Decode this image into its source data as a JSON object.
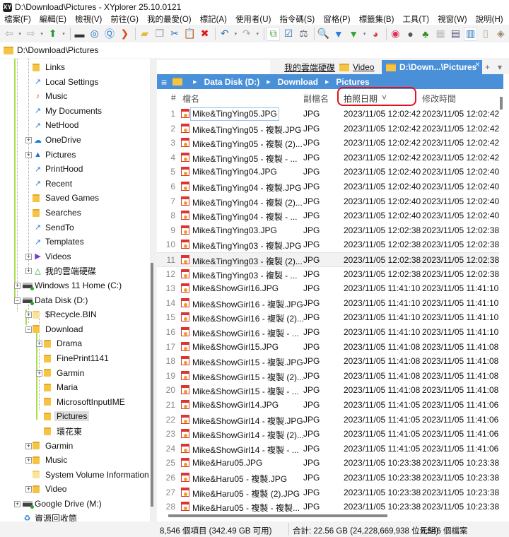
{
  "window": {
    "title": "D:\\Download\\Pictures - XYplorer 25.10.0121",
    "logo": "XY"
  },
  "menu": [
    "檔案(F)",
    "編輯(E)",
    "檢視(V)",
    "前往(G)",
    "我的最愛(O)",
    "標記(A)",
    "使用者(U)",
    "指令碼(S)",
    "窗格(P)",
    "標籤集(B)",
    "工具(T)",
    "視窗(W)",
    "說明(H)"
  ],
  "toolbar": [
    {
      "name": "back-icon",
      "glyph": "⇦",
      "color": "#9aa",
      "dd": true
    },
    {
      "name": "forward-icon",
      "glyph": "⇨",
      "color": "#9aa",
      "dd": true
    },
    {
      "name": "up-icon",
      "glyph": "⬆",
      "color": "#2a9a3a",
      "dd": true
    },
    {
      "sep": true
    },
    {
      "name": "computer-icon",
      "glyph": "▬",
      "color": "#333"
    },
    {
      "name": "target-icon",
      "glyph": "◎",
      "color": "#2a6fb8"
    },
    {
      "name": "search-circle-icon",
      "glyph": "Ⓠ",
      "color": "#2a7fd8"
    },
    {
      "name": "goto-icon",
      "glyph": "❯",
      "color": "#e04a1a"
    },
    {
      "sep": true
    },
    {
      "name": "new-folder-icon",
      "glyph": "▰",
      "color": "#e8b93a"
    },
    {
      "name": "copy-icon",
      "glyph": "❐",
      "color": "#999"
    },
    {
      "name": "cut-icon",
      "glyph": "✂",
      "color": "#2a6fb8"
    },
    {
      "name": "paste-icon",
      "glyph": "📋",
      "color": "#a87"
    },
    {
      "name": "delete-icon",
      "glyph": "✖",
      "color": "#e01a1a"
    },
    {
      "sep": true
    },
    {
      "name": "undo-icon",
      "glyph": "↶",
      "color": "#2a6fb8",
      "dd": true
    },
    {
      "name": "redo-icon",
      "glyph": "↷",
      "color": "#aab",
      "dd": true
    },
    {
      "sep": true
    },
    {
      "name": "tree-toggle-icon",
      "glyph": "⧉",
      "color": "#4a4",
      "on": true
    },
    {
      "name": "checkbox-icon",
      "glyph": "☑",
      "color": "#2a6fb8"
    },
    {
      "name": "weight-icon",
      "glyph": "⚖",
      "color": "#667"
    },
    {
      "sep": true
    },
    {
      "name": "find-icon",
      "glyph": "🔍",
      "color": "#2a7fd8"
    },
    {
      "name": "filter-icon",
      "glyph": "▼",
      "color": "#2a7fd8"
    },
    {
      "name": "green-filter-icon",
      "glyph": "▼",
      "color": "#3aa53a",
      "dd": true
    },
    {
      "name": "pie-icon",
      "glyph": "◕",
      "color": "#e03a3a"
    },
    {
      "sep": true
    },
    {
      "name": "spiral-icon",
      "glyph": "◉",
      "color": "#e0305a"
    },
    {
      "name": "moon-icon",
      "glyph": "●",
      "color": "#555"
    },
    {
      "name": "tree-icon",
      "glyph": "♣",
      "color": "#3a8a2a"
    },
    {
      "name": "grid-icon",
      "glyph": "▦",
      "color": "#bbb"
    },
    {
      "name": "details-icon",
      "glyph": "▤",
      "color": "#557"
    },
    {
      "name": "dual-pane-icon",
      "glyph": "▥",
      "color": "#2a6fb8",
      "on": true
    },
    {
      "name": "panel-icon",
      "glyph": "▯",
      "color": "#b9a37a"
    },
    {
      "name": "tag-icon",
      "glyph": "◈",
      "color": "#998866"
    }
  ],
  "address": "D:\\Download\\Pictures",
  "tree": [
    {
      "label": "Links",
      "level": 1,
      "icon": "folder"
    },
    {
      "label": "Local Settings",
      "level": 1,
      "icon": "shortcut"
    },
    {
      "label": "Music",
      "level": 1,
      "icon": "music"
    },
    {
      "label": "My Documents",
      "level": 1,
      "icon": "shortcut"
    },
    {
      "label": "NetHood",
      "level": 1,
      "icon": "shortcut"
    },
    {
      "label": "OneDrive",
      "level": 1,
      "icon": "cloud",
      "exp": "+"
    },
    {
      "label": "Pictures",
      "level": 1,
      "icon": "pictures",
      "exp": "+"
    },
    {
      "label": "PrintHood",
      "level": 1,
      "icon": "shortcut"
    },
    {
      "label": "Recent",
      "level": 1,
      "icon": "shortcut"
    },
    {
      "label": "Saved Games",
      "level": 1,
      "icon": "folder"
    },
    {
      "label": "Searches",
      "level": 1,
      "icon": "folder"
    },
    {
      "label": "SendTo",
      "level": 1,
      "icon": "shortcut"
    },
    {
      "label": "Templates",
      "level": 1,
      "icon": "shortcut"
    },
    {
      "label": "Videos",
      "level": 1,
      "icon": "video",
      "exp": "+"
    },
    {
      "label": "我的雲端硬碟",
      "level": 1,
      "icon": "gdrive",
      "exp": "+"
    },
    {
      "label": "Windows 11 Home (C:)",
      "level": 0,
      "icon": "drive",
      "exp": "+"
    },
    {
      "label": "Data Disk (D:)",
      "level": 0,
      "icon": "drive",
      "exp": "−"
    },
    {
      "label": "$Recycle.BIN",
      "level": 1,
      "icon": "folder-light",
      "exp": "+"
    },
    {
      "label": "Download",
      "level": 1,
      "icon": "folder",
      "exp": "−"
    },
    {
      "label": "Drama",
      "level": 2,
      "icon": "folder",
      "exp": "+"
    },
    {
      "label": "FinePrint1141",
      "level": 2,
      "icon": "folder"
    },
    {
      "label": "Garmin",
      "level": 2,
      "icon": "folder",
      "exp": "+"
    },
    {
      "label": "Maria",
      "level": 2,
      "icon": "folder"
    },
    {
      "label": "MicrosoftInputIME",
      "level": 2,
      "icon": "folder"
    },
    {
      "label": "Pictures",
      "level": 2,
      "icon": "folder",
      "selected": true
    },
    {
      "label": "環花東",
      "level": 2,
      "icon": "folder"
    },
    {
      "label": "Garmin",
      "level": 1,
      "icon": "folder",
      "exp": "+"
    },
    {
      "label": "Music",
      "level": 1,
      "icon": "folder",
      "exp": "+"
    },
    {
      "label": "System Volume Information",
      "level": 1,
      "icon": "folder-light"
    },
    {
      "label": "Video",
      "level": 1,
      "icon": "folder",
      "exp": "+"
    },
    {
      "label": "Google Drive (M:)",
      "level": 0,
      "icon": "drive",
      "exp": "+"
    },
    {
      "label": "資源回收筒",
      "level": 0,
      "icon": "recycle"
    }
  ],
  "tabs": {
    "items": [
      "我的雲端硬碟",
      "Video",
      "D:\\Down...\\Pictures"
    ],
    "add": "+",
    "menu": "▾",
    "close": "×"
  },
  "breadcrumb": [
    "Data Disk (D:)",
    "Download",
    "Pictures"
  ],
  "columns": {
    "num": "#",
    "name": "檔名",
    "ext": "副檔名",
    "taken": "拍照日期",
    "sort": "˅",
    "modified": "修改時間"
  },
  "files": [
    [
      "Mike&TingYing05.JPG",
      "JPG",
      "2023/11/05 12:02:42",
      "2023/11/05 12:02:42"
    ],
    [
      "Mike&TingYing05 - 複製.JPG",
      "JPG",
      "2023/11/05 12:02:42",
      "2023/11/05 12:02:42"
    ],
    [
      "Mike&TingYing05 - 複製 (2)...",
      "JPG",
      "2023/11/05 12:02:42",
      "2023/11/05 12:02:42"
    ],
    [
      "Mike&TingYing05 - 複製 - ...",
      "JPG",
      "2023/11/05 12:02:42",
      "2023/11/05 12:02:42"
    ],
    [
      "Mike&TingYing04.JPG",
      "JPG",
      "2023/11/05 12:02:40",
      "2023/11/05 12:02:40"
    ],
    [
      "Mike&TingYing04 - 複製.JPG",
      "JPG",
      "2023/11/05 12:02:40",
      "2023/11/05 12:02:40"
    ],
    [
      "Mike&TingYing04 - 複製 (2)...",
      "JPG",
      "2023/11/05 12:02:40",
      "2023/11/05 12:02:40"
    ],
    [
      "Mike&TingYing04 - 複製 - ...",
      "JPG",
      "2023/11/05 12:02:40",
      "2023/11/05 12:02:40"
    ],
    [
      "Mike&TingYing03.JPG",
      "JPG",
      "2023/11/05 12:02:38",
      "2023/11/05 12:02:38"
    ],
    [
      "Mike&TingYing03 - 複製.JPG",
      "JPG",
      "2023/11/05 12:02:38",
      "2023/11/05 12:02:38"
    ],
    [
      "Mike&TingYing03 - 複製 (2)...",
      "JPG",
      "2023/11/05 12:02:38",
      "2023/11/05 12:02:38"
    ],
    [
      "Mike&TingYing03 - 複製 - ...",
      "JPG",
      "2023/11/05 12:02:38",
      "2023/11/05 12:02:38"
    ],
    [
      "Mike&ShowGirl16.JPG",
      "JPG",
      "2023/11/05 11:41:10",
      "2023/11/05 11:41:10"
    ],
    [
      "Mike&ShowGirl16 - 複製.JPG",
      "JPG",
      "2023/11/05 11:41:10",
      "2023/11/05 11:41:10"
    ],
    [
      "Mike&ShowGirl16 - 複製 (2)...",
      "JPG",
      "2023/11/05 11:41:10",
      "2023/11/05 11:41:10"
    ],
    [
      "Mike&ShowGirl16 - 複製 - ...",
      "JPG",
      "2023/11/05 11:41:10",
      "2023/11/05 11:41:10"
    ],
    [
      "Mike&ShowGirl15.JPG",
      "JPG",
      "2023/11/05 11:41:08",
      "2023/11/05 11:41:08"
    ],
    [
      "Mike&ShowGirl15 - 複製.JPG",
      "JPG",
      "2023/11/05 11:41:08",
      "2023/11/05 11:41:08"
    ],
    [
      "Mike&ShowGirl15 - 複製 (2)...",
      "JPG",
      "2023/11/05 11:41:08",
      "2023/11/05 11:41:08"
    ],
    [
      "Mike&ShowGirl15 - 複製 - ...",
      "JPG",
      "2023/11/05 11:41:08",
      "2023/11/05 11:41:08"
    ],
    [
      "Mike&ShowGirl14.JPG",
      "JPG",
      "2023/11/05 11:41:05",
      "2023/11/05 11:41:06"
    ],
    [
      "Mike&ShowGirl14 - 複製.JPG",
      "JPG",
      "2023/11/05 11:41:05",
      "2023/11/05 11:41:06"
    ],
    [
      "Mike&ShowGirl14 - 複製 (2)...",
      "JPG",
      "2023/11/05 11:41:05",
      "2023/11/05 11:41:06"
    ],
    [
      "Mike&ShowGirl14 - 複製 - ...",
      "JPG",
      "2023/11/05 11:41:05",
      "2023/11/05 11:41:06"
    ],
    [
      "Mike&Haru05.JPG",
      "JPG",
      "2023/11/05 10:23:38",
      "2023/11/05 10:23:38"
    ],
    [
      "Mike&Haru05 - 複製.JPG",
      "JPG",
      "2023/11/05 10:23:38",
      "2023/11/05 10:23:38"
    ],
    [
      "Mike&Haru05 - 複製 (2).JPG",
      "JPG",
      "2023/11/05 10:23:38",
      "2023/11/05 10:23:38"
    ],
    [
      "Mike&Haru05 - 複製 - 複製...",
      "JPG",
      "2023/11/05 10:23:38",
      "2023/11/05 10:23:38"
    ]
  ],
  "status": {
    "items": "8,546 個項目 (342.49 GB 可用)",
    "total": "合計: 22.56 GB (24,228,669,938 位元組)",
    "files": "8,546 個檔案"
  }
}
